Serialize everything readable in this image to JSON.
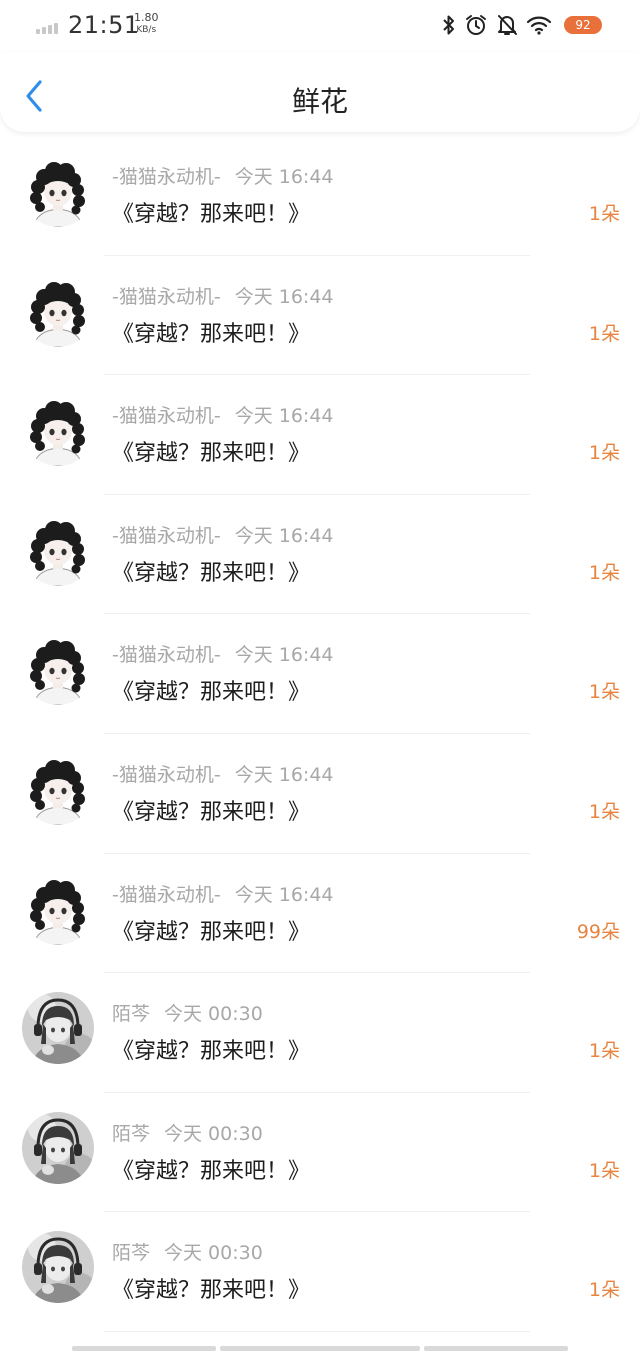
{
  "status_bar": {
    "time": "21:51",
    "net_speed_value": "1.80",
    "net_speed_unit": "KB/s",
    "battery": "92",
    "icons": [
      "signal-icon",
      "bluetooth-icon",
      "alarm-icon",
      "mute-icon",
      "wifi-icon",
      "battery-icon"
    ]
  },
  "header": {
    "back_icon": "chevron-left-icon",
    "title": "鲜花"
  },
  "colors": {
    "accent_blue": "#2f8fe8",
    "count_orange": "#e8843f",
    "battery_orange": "#e8703a",
    "meta_gray": "#a8a8a8"
  },
  "items": [
    {
      "user": "-猫猫永动机-",
      "time": "今天 16:44",
      "book": "《穿越？那来吧！》",
      "count": "1朵",
      "avatar": "curly-hair-avatar"
    },
    {
      "user": "-猫猫永动机-",
      "time": "今天 16:44",
      "book": "《穿越？那来吧！》",
      "count": "1朵",
      "avatar": "curly-hair-avatar"
    },
    {
      "user": "-猫猫永动机-",
      "time": "今天 16:44",
      "book": "《穿越？那来吧！》",
      "count": "1朵",
      "avatar": "curly-hair-avatar"
    },
    {
      "user": "-猫猫永动机-",
      "time": "今天 16:44",
      "book": "《穿越？那来吧！》",
      "count": "1朵",
      "avatar": "curly-hair-avatar"
    },
    {
      "user": "-猫猫永动机-",
      "time": "今天 16:44",
      "book": "《穿越？那来吧！》",
      "count": "1朵",
      "avatar": "curly-hair-avatar"
    },
    {
      "user": "-猫猫永动机-",
      "time": "今天 16:44",
      "book": "《穿越？那来吧！》",
      "count": "1朵",
      "avatar": "curly-hair-avatar"
    },
    {
      "user": "-猫猫永动机-",
      "time": "今天 16:44",
      "book": "《穿越？那来吧！》",
      "count": "99朵",
      "avatar": "curly-hair-avatar"
    },
    {
      "user": "陌芩",
      "time": "今天 00:30",
      "book": "《穿越？那来吧！》",
      "count": "1朵",
      "avatar": "headphones-avatar"
    },
    {
      "user": "陌芩",
      "time": "今天 00:30",
      "book": "《穿越？那来吧！》",
      "count": "1朵",
      "avatar": "headphones-avatar"
    },
    {
      "user": "陌芩",
      "time": "今天 00:30",
      "book": "《穿越？那来吧！》",
      "count": "1朵",
      "avatar": "headphones-avatar"
    }
  ]
}
